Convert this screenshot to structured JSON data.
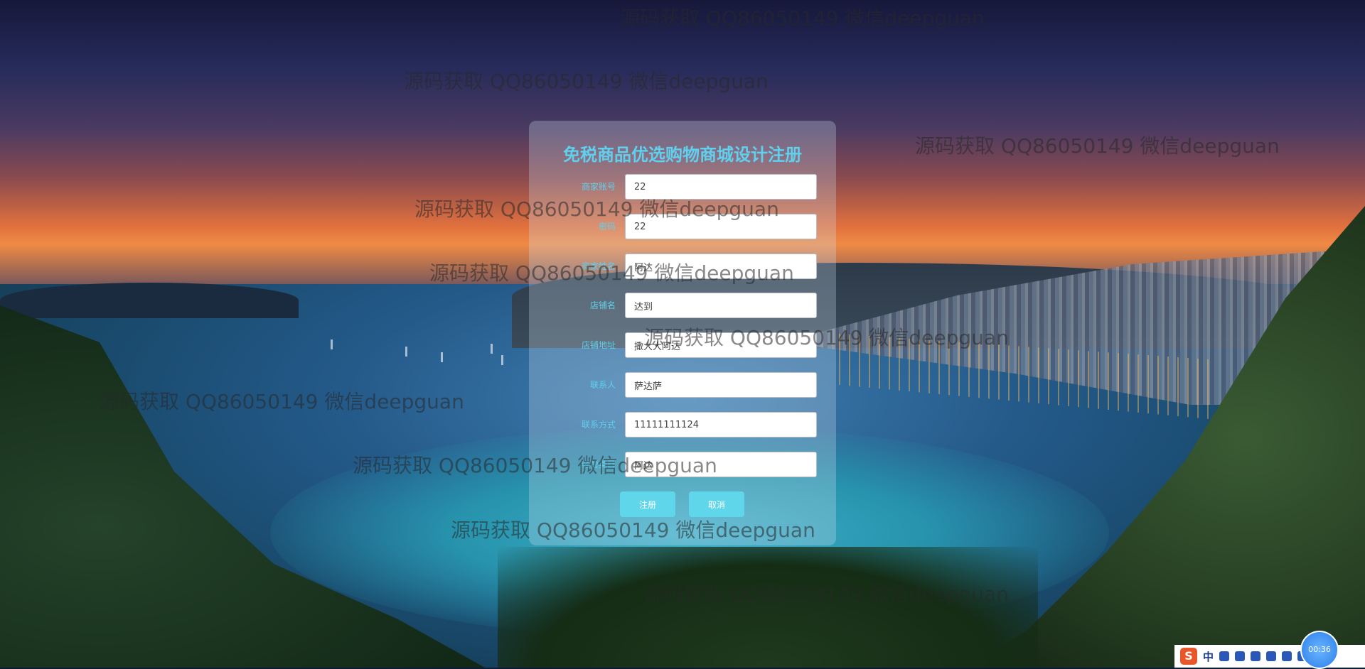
{
  "form": {
    "title": "免税商品优选购物商城设计注册",
    "fields": [
      {
        "label": "商家账号",
        "value": "22"
      },
      {
        "label": "密码",
        "value": "22"
      },
      {
        "label": "商家姓名",
        "value": "阿达"
      },
      {
        "label": "店铺名",
        "value": "达到"
      },
      {
        "label": "店铺地址",
        "value": "撒大大阿达"
      },
      {
        "label": "联系人",
        "value": "萨达萨"
      },
      {
        "label": "联系方式",
        "value": "11111111124"
      },
      {
        "label": "经营类目",
        "value": "阿达"
      }
    ],
    "register_label": "注册",
    "cancel_label": "取消"
  },
  "watermark_text": "源码获取 QQ86050149 微信deepguan",
  "tray": {
    "logo": "S",
    "ime_mode": "中",
    "clock": "00:36"
  },
  "colors": {
    "accent": "#5fd0ee",
    "button": "#5fd6ea"
  }
}
